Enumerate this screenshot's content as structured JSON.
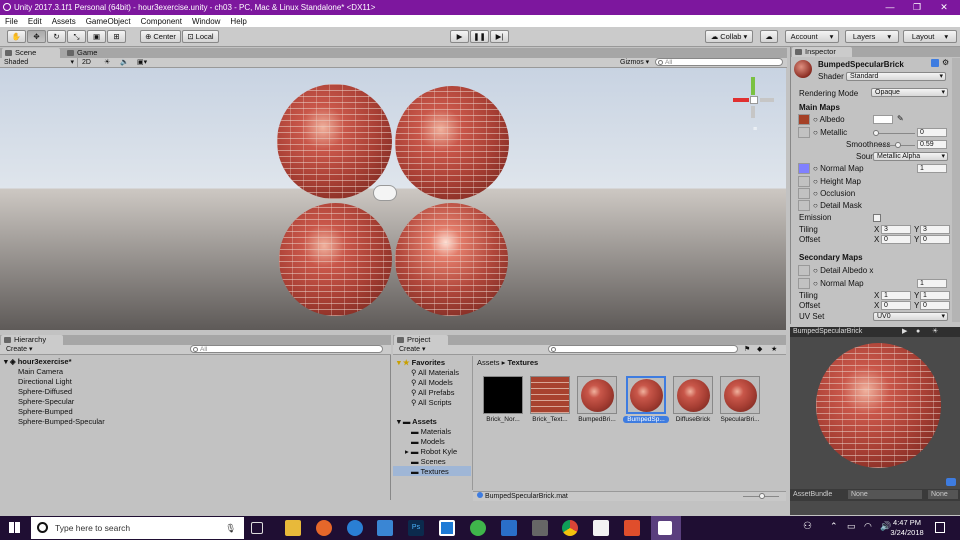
{
  "titlebar": {
    "title": "Unity 2017.3.1f1 Personal (64bit) - hour3exercise.unity - ch03 - PC, Mac & Linux Standalone* <DX11>",
    "minimize": "—",
    "maximize": "❐",
    "close": "✕"
  },
  "menu": [
    "File",
    "Edit",
    "Assets",
    "GameObject",
    "Component",
    "Window",
    "Help"
  ],
  "toolbar": {
    "center_label": "Center",
    "local_label": "Local",
    "collab_label": "Collab ▾",
    "account_label": "Account",
    "layers_label": "Layers",
    "layout_label": "Layout"
  },
  "scene": {
    "tab_scene": "Scene",
    "tab_game": "Game",
    "shading_mode": "Shaded",
    "mode_2d": "2D",
    "gizmos_label": "Gizmos ▾",
    "search_placeholder": "All"
  },
  "inspector": {
    "tab_label": "Inspector",
    "material_name": "BumpedSpecularBrick",
    "shader_label": "Shader",
    "shader_value": "Standard",
    "rendering_mode_label": "Rendering Mode",
    "rendering_mode_value": "Opaque",
    "main_maps_header": "Main Maps",
    "albedo_label": "Albedo",
    "metallic_label": "Metallic",
    "metallic_value": "0",
    "metallic_level": 0,
    "smoothness_label": "Smoothness",
    "smoothness_value": "0.59",
    "smoothness_level": 0.59,
    "source_label": "Source",
    "source_value": "Metallic Alpha",
    "normal_map_label": "Normal Map",
    "normal_map_value": "1",
    "height_map_label": "Height Map",
    "occlusion_label": "Occlusion",
    "detail_mask_label": "Detail Mask",
    "emission_label": "Emission",
    "tiling_label": "Tiling",
    "offset_label": "Offset",
    "tiling_x": "3",
    "tiling_y": "3",
    "offset_x": "0",
    "offset_y": "0",
    "x_label": "X",
    "y_label": "Y",
    "secondary_maps_header": "Secondary Maps",
    "detail_albedo_label": "Detail Albedo x",
    "sec_normal_map_label": "Normal Map",
    "sec_normal_map_value": "1",
    "sec_tiling_x": "1",
    "sec_tiling_y": "1",
    "sec_offset_x": "0",
    "sec_offset_y": "0",
    "uv_set_label": "UV Set",
    "uv_set_value": "UV0"
  },
  "preview": {
    "title": "BumpedSpecularBrick",
    "assetbundle_label": "AssetBundle",
    "none_1": "None",
    "none_2": "None"
  },
  "hierarchy": {
    "tab_label": "Hierarchy",
    "create_label": "Create ▾",
    "search_placeholder": "All",
    "scene_name": "hour3exercise*",
    "items": [
      "Main Camera",
      "Directional Light",
      "Sphere-Diffused",
      "Sphere-Specular",
      "Sphere-Bumped",
      "Sphere-Bumped-Specular"
    ]
  },
  "project": {
    "tab_label": "Project",
    "create_label": "Create ▾",
    "favorites_label": "Favorites",
    "favorites": [
      "All Materials",
      "All Models",
      "All Prefabs",
      "All Scripts"
    ],
    "assets_label": "Assets",
    "folders": [
      "Materials",
      "Models",
      "Robot Kyle",
      "Scenes",
      "Textures"
    ],
    "breadcrumb_root": "Assets",
    "breadcrumb_sep": "▸",
    "breadcrumb_leaf": "Textures",
    "assets": [
      "Brick_Nor...",
      "Brick_Text...",
      "BumpedBri...",
      "BumpedSp...",
      "DiffuseBrick",
      "SpecularBri..."
    ],
    "selected_file": "BumpedSpecularBrick.mat"
  },
  "taskbar": {
    "search_placeholder": "Type here to search",
    "time": "4:47 PM",
    "date": "3/24/2018"
  },
  "colors": {
    "title_purple": "#7d179e",
    "albedo_swatch": "#a54127",
    "normal_swatch": "#8080ff",
    "selection_blue": "#3e7ce0",
    "taskbar": "#1f0e33"
  }
}
